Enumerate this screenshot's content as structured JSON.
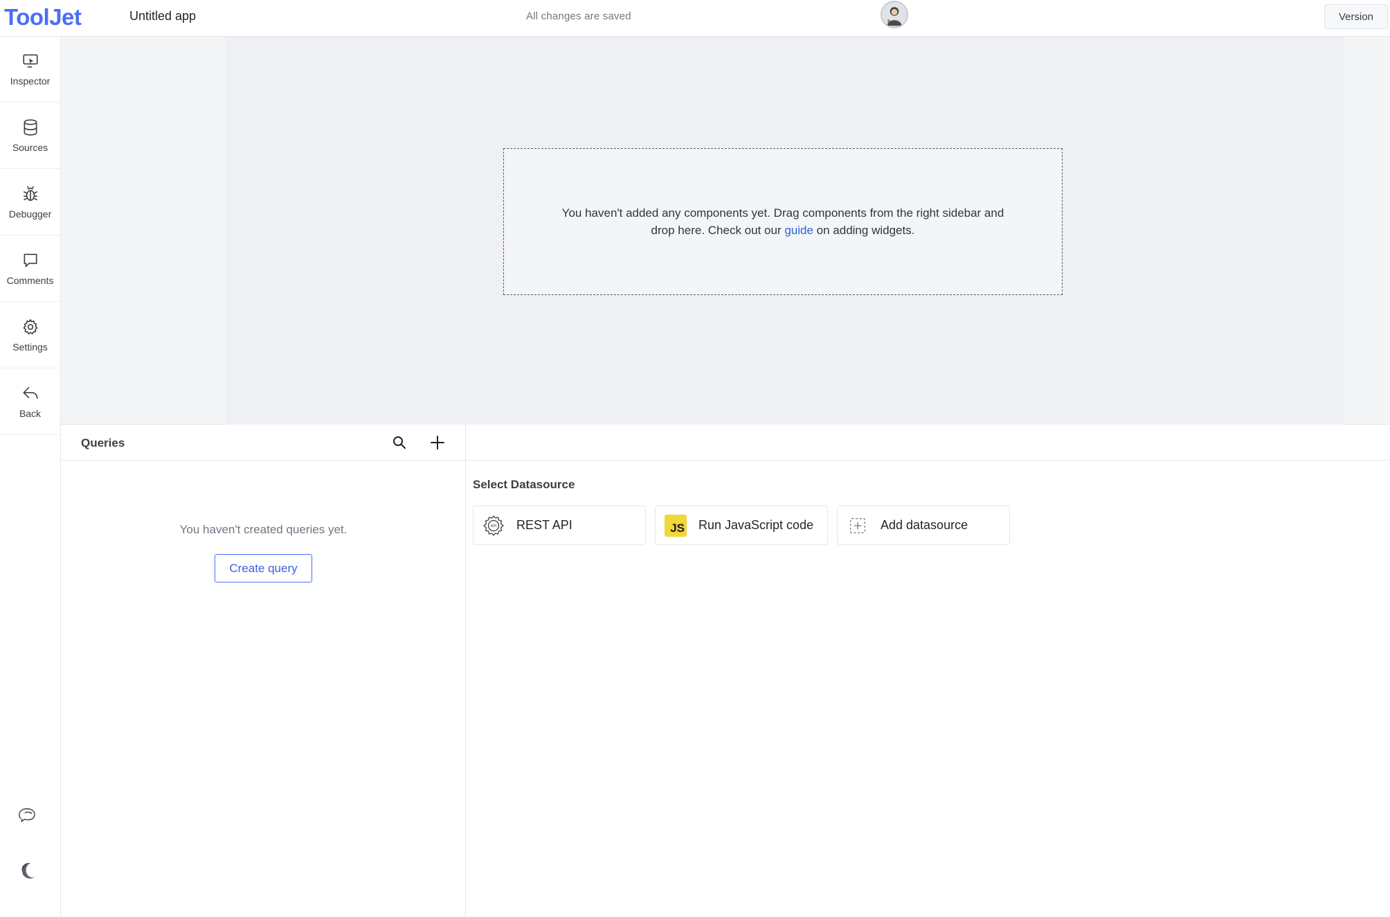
{
  "header": {
    "logo": "ToolJet",
    "app_name": "Untitled app",
    "save_status": "All changes are saved",
    "version_label": "Version"
  },
  "sidebar": {
    "items": [
      {
        "label": "Inspector",
        "icon": "inspector-icon"
      },
      {
        "label": "Sources",
        "icon": "database-icon"
      },
      {
        "label": "Debugger",
        "icon": "bug-icon"
      },
      {
        "label": "Comments",
        "icon": "comment-icon"
      },
      {
        "label": "Settings",
        "icon": "gear-icon"
      },
      {
        "label": "Back",
        "icon": "back-arrow-icon"
      }
    ],
    "bottom_icons": [
      "chat-support-icon",
      "moon-icon"
    ]
  },
  "canvas": {
    "empty_text_before": "You haven't added any components yet. Drag components from the right sidebar and drop here. Check out our ",
    "guide_link": "guide",
    "empty_text_after": " on adding widgets."
  },
  "queries": {
    "title": "Queries",
    "empty_text": "You haven't created queries yet.",
    "create_button": "Create query"
  },
  "datasources": {
    "title": "Select Datasource",
    "items": [
      {
        "label": "REST API",
        "icon": "api-gear-icon"
      },
      {
        "label": "Run JavaScript code",
        "icon": "js-icon",
        "badge": "JS"
      },
      {
        "label": "Add datasource",
        "icon": "add-datasource-icon"
      }
    ]
  },
  "colors": {
    "brand": "#4c6ef5",
    "link": "#2f63d4",
    "js_badge": "#f1d73a"
  }
}
